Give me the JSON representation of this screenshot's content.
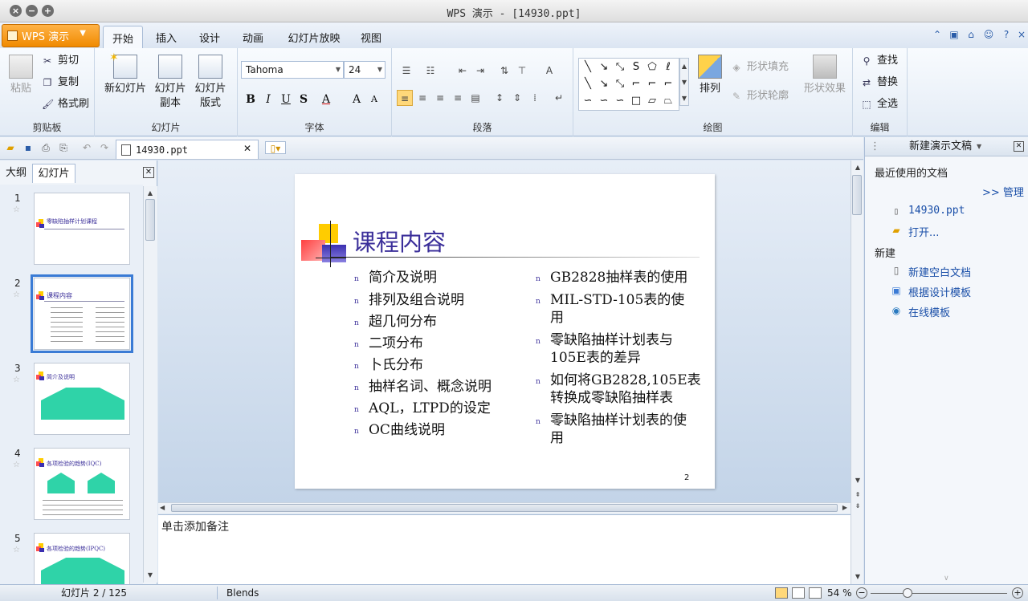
{
  "window": {
    "title": "WPS 演示 - [14930.ppt]"
  },
  "app_button": {
    "label": "WPS 演示"
  },
  "tabs": [
    {
      "label": "开始",
      "active": true
    },
    {
      "label": "插入"
    },
    {
      "label": "设计"
    },
    {
      "label": "动画"
    },
    {
      "label": "幻灯片放映"
    },
    {
      "label": "视图"
    }
  ],
  "ribbon": {
    "clipboard": {
      "label": "剪贴板",
      "paste": "粘贴",
      "cut": "剪切",
      "copy": "复制",
      "format_painter": "格式刷"
    },
    "slides": {
      "label": "幻灯片",
      "new_slide": "新幻灯片",
      "duplicate_1": "幻灯片",
      "duplicate_2": "副本",
      "layout_1": "幻灯片",
      "layout_2": "版式"
    },
    "font": {
      "label": "字体",
      "family": "Tahoma",
      "size": "24",
      "bold": "B",
      "italic": "I",
      "underline": "U",
      "strike": "S",
      "color": "A",
      "grow": "A",
      "shrink": "A"
    },
    "paragraph": {
      "label": "段落"
    },
    "drawing": {
      "label": "绘图",
      "arrange": "排列",
      "shape_fill": "形状填充",
      "shape_outline": "形状轮廓",
      "shape_effects": "形状效果"
    },
    "editing": {
      "label": "编辑",
      "find": "查找",
      "replace": "替换",
      "select_all": "全选"
    }
  },
  "document_tab": {
    "name": "14930.ppt"
  },
  "left_panel": {
    "tabs": [
      "大纲",
      "幻灯片"
    ],
    "slides": [
      {
        "num": "1",
        "title": "零缺陷抽样计划课程"
      },
      {
        "num": "2",
        "title": "课程内容"
      },
      {
        "num": "3",
        "title": "简介及说明"
      },
      {
        "num": "4",
        "title": "各项检验的趋势(IQC)"
      },
      {
        "num": "5",
        "title": "各项检验的趋势(IPQC)"
      }
    ]
  },
  "slide": {
    "title": "课程内容",
    "left_bullets": [
      "简介及说明",
      "排列及组合说明",
      "超几何分布",
      "二项分布",
      "卜氏分布",
      "抽样名词、概念说明",
      "AQL，LTPD的设定",
      "OC曲线说明"
    ],
    "right_bullets": [
      "GB2828抽样表的使用",
      "MIL-STD-105表的使用",
      "零缺陷抽样计划表与105E表的差异",
      "如何将GB2828,105E表转换成零缺陷抽样表",
      "零缺陷抽样计划表的使用"
    ],
    "page_number": "2"
  },
  "notes": {
    "placeholder": "单击添加备注"
  },
  "task_pane": {
    "title": "新建演示文稿",
    "recent_header": "最近使用的文档",
    "manage": ">> 管理",
    "recent_file": "14930.ppt",
    "open": "打开...",
    "new_header": "新建",
    "new_blank": "新建空白文档",
    "from_template": "根据设计模板",
    "online_template": "在线模板"
  },
  "status": {
    "slide_counter": "幻灯片 2 / 125",
    "theme": "Blends",
    "zoom": "54 %"
  }
}
